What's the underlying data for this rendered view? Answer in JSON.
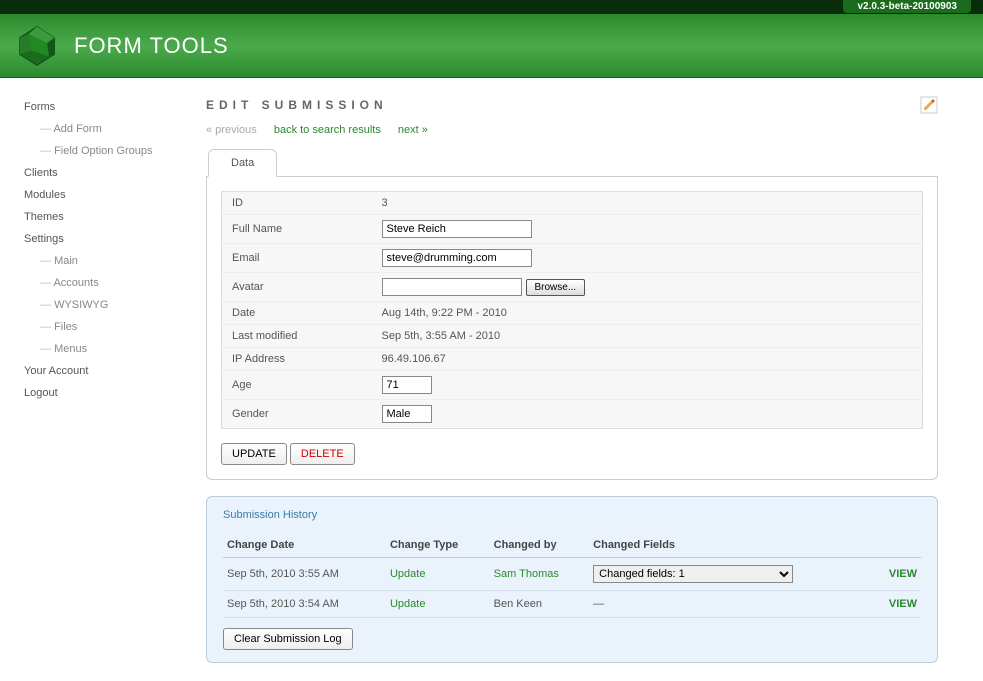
{
  "version": "v2.0.3-beta-20100903",
  "app_name": "FORM TOOLS",
  "sidebar": {
    "items": [
      {
        "label": "Forms",
        "sub": false
      },
      {
        "label": "Add Form",
        "sub": true
      },
      {
        "label": "Field Option Groups",
        "sub": true
      },
      {
        "label": "Clients",
        "sub": false
      },
      {
        "label": "Modules",
        "sub": false
      },
      {
        "label": "Themes",
        "sub": false
      },
      {
        "label": "Settings",
        "sub": false
      },
      {
        "label": "Main",
        "sub": true
      },
      {
        "label": "Accounts",
        "sub": true
      },
      {
        "label": "WYSIWYG",
        "sub": true
      },
      {
        "label": "Files",
        "sub": true
      },
      {
        "label": "Menus",
        "sub": true
      },
      {
        "label": "Your Account",
        "sub": false
      },
      {
        "label": "Logout",
        "sub": false
      }
    ]
  },
  "page_title": "EDIT SUBMISSION",
  "nav": {
    "prev": "« previous",
    "back": "back to search results",
    "next": "next »"
  },
  "tab_label": "Data",
  "form": {
    "id_label": "ID",
    "id_value": "3",
    "fullname_label": "Full Name",
    "fullname_value": "Steve Reich",
    "email_label": "Email",
    "email_value": "steve@drumming.com",
    "avatar_label": "Avatar",
    "avatar_value": "",
    "browse_label": "Browse...",
    "date_label": "Date",
    "date_value": "Aug 14th, 9:22 PM - 2010",
    "modified_label": "Last modified",
    "modified_value": "Sep 5th, 3:55 AM - 2010",
    "ip_label": "IP Address",
    "ip_value": "96.49.106.67",
    "age_label": "Age",
    "age_value": "71",
    "gender_label": "Gender",
    "gender_value": "Male"
  },
  "buttons": {
    "update": "UPDATE",
    "delete": "DELETE",
    "clear_log": "Clear Submission Log"
  },
  "history": {
    "title": "Submission History",
    "headers": {
      "date": "Change Date",
      "type": "Change Type",
      "by": "Changed by",
      "fields": "Changed Fields"
    },
    "rows": [
      {
        "date": "Sep 5th, 2010 3:55 AM",
        "type": "Update",
        "by": "Sam Thomas",
        "by_link": true,
        "fields_select": "Changed fields: 1",
        "view": "VIEW"
      },
      {
        "date": "Sep 5th, 2010 3:54 AM",
        "type": "Update",
        "by": "Ben Keen",
        "by_link": false,
        "fields_select": "—",
        "view": "VIEW"
      }
    ]
  }
}
